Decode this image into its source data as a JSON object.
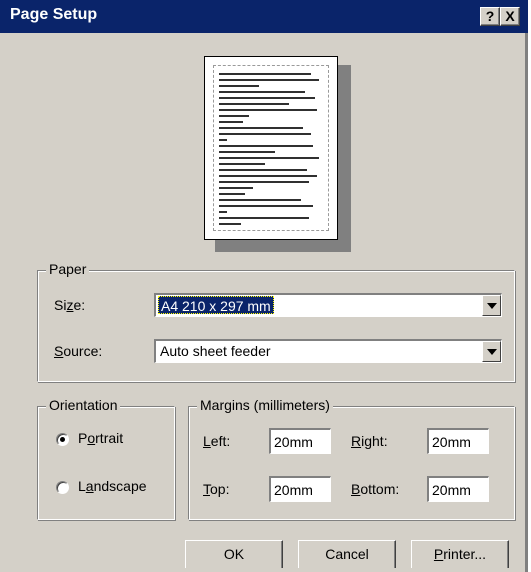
{
  "window": {
    "title": "Page Setup",
    "help_label": "?",
    "close_label": "X"
  },
  "paper": {
    "legend": "Paper",
    "size_label_pre": "Si",
    "size_label_key": "z",
    "size_label_post": "e:",
    "size_value": "A4 210 x 297 mm",
    "source_label_key": "S",
    "source_label_post": "ource:",
    "source_value": "Auto sheet feeder"
  },
  "orientation": {
    "legend": "Orientation",
    "portrait_pre": "P",
    "portrait_key": "o",
    "portrait_post": "rtrait",
    "landscape_pre": "L",
    "landscape_key": "a",
    "landscape_post": "ndscape",
    "selected": "portrait"
  },
  "margins": {
    "legend": "Margins (millimeters)",
    "left_key": "L",
    "left_post": "eft:",
    "left_value": "20mm",
    "right_key": "R",
    "right_post": "ight:",
    "right_value": "20mm",
    "top_key": "T",
    "top_post": "op:",
    "top_value": "20mm",
    "bottom_key": "B",
    "bottom_post": "ottom:",
    "bottom_value": "20mm"
  },
  "buttons": {
    "ok": "OK",
    "cancel": "Cancel",
    "printer_key": "P",
    "printer_post": "rinter..."
  },
  "colors": {
    "title_bar": "#0a246a",
    "face": "#d4d0c8",
    "selection": "#0a246a"
  }
}
